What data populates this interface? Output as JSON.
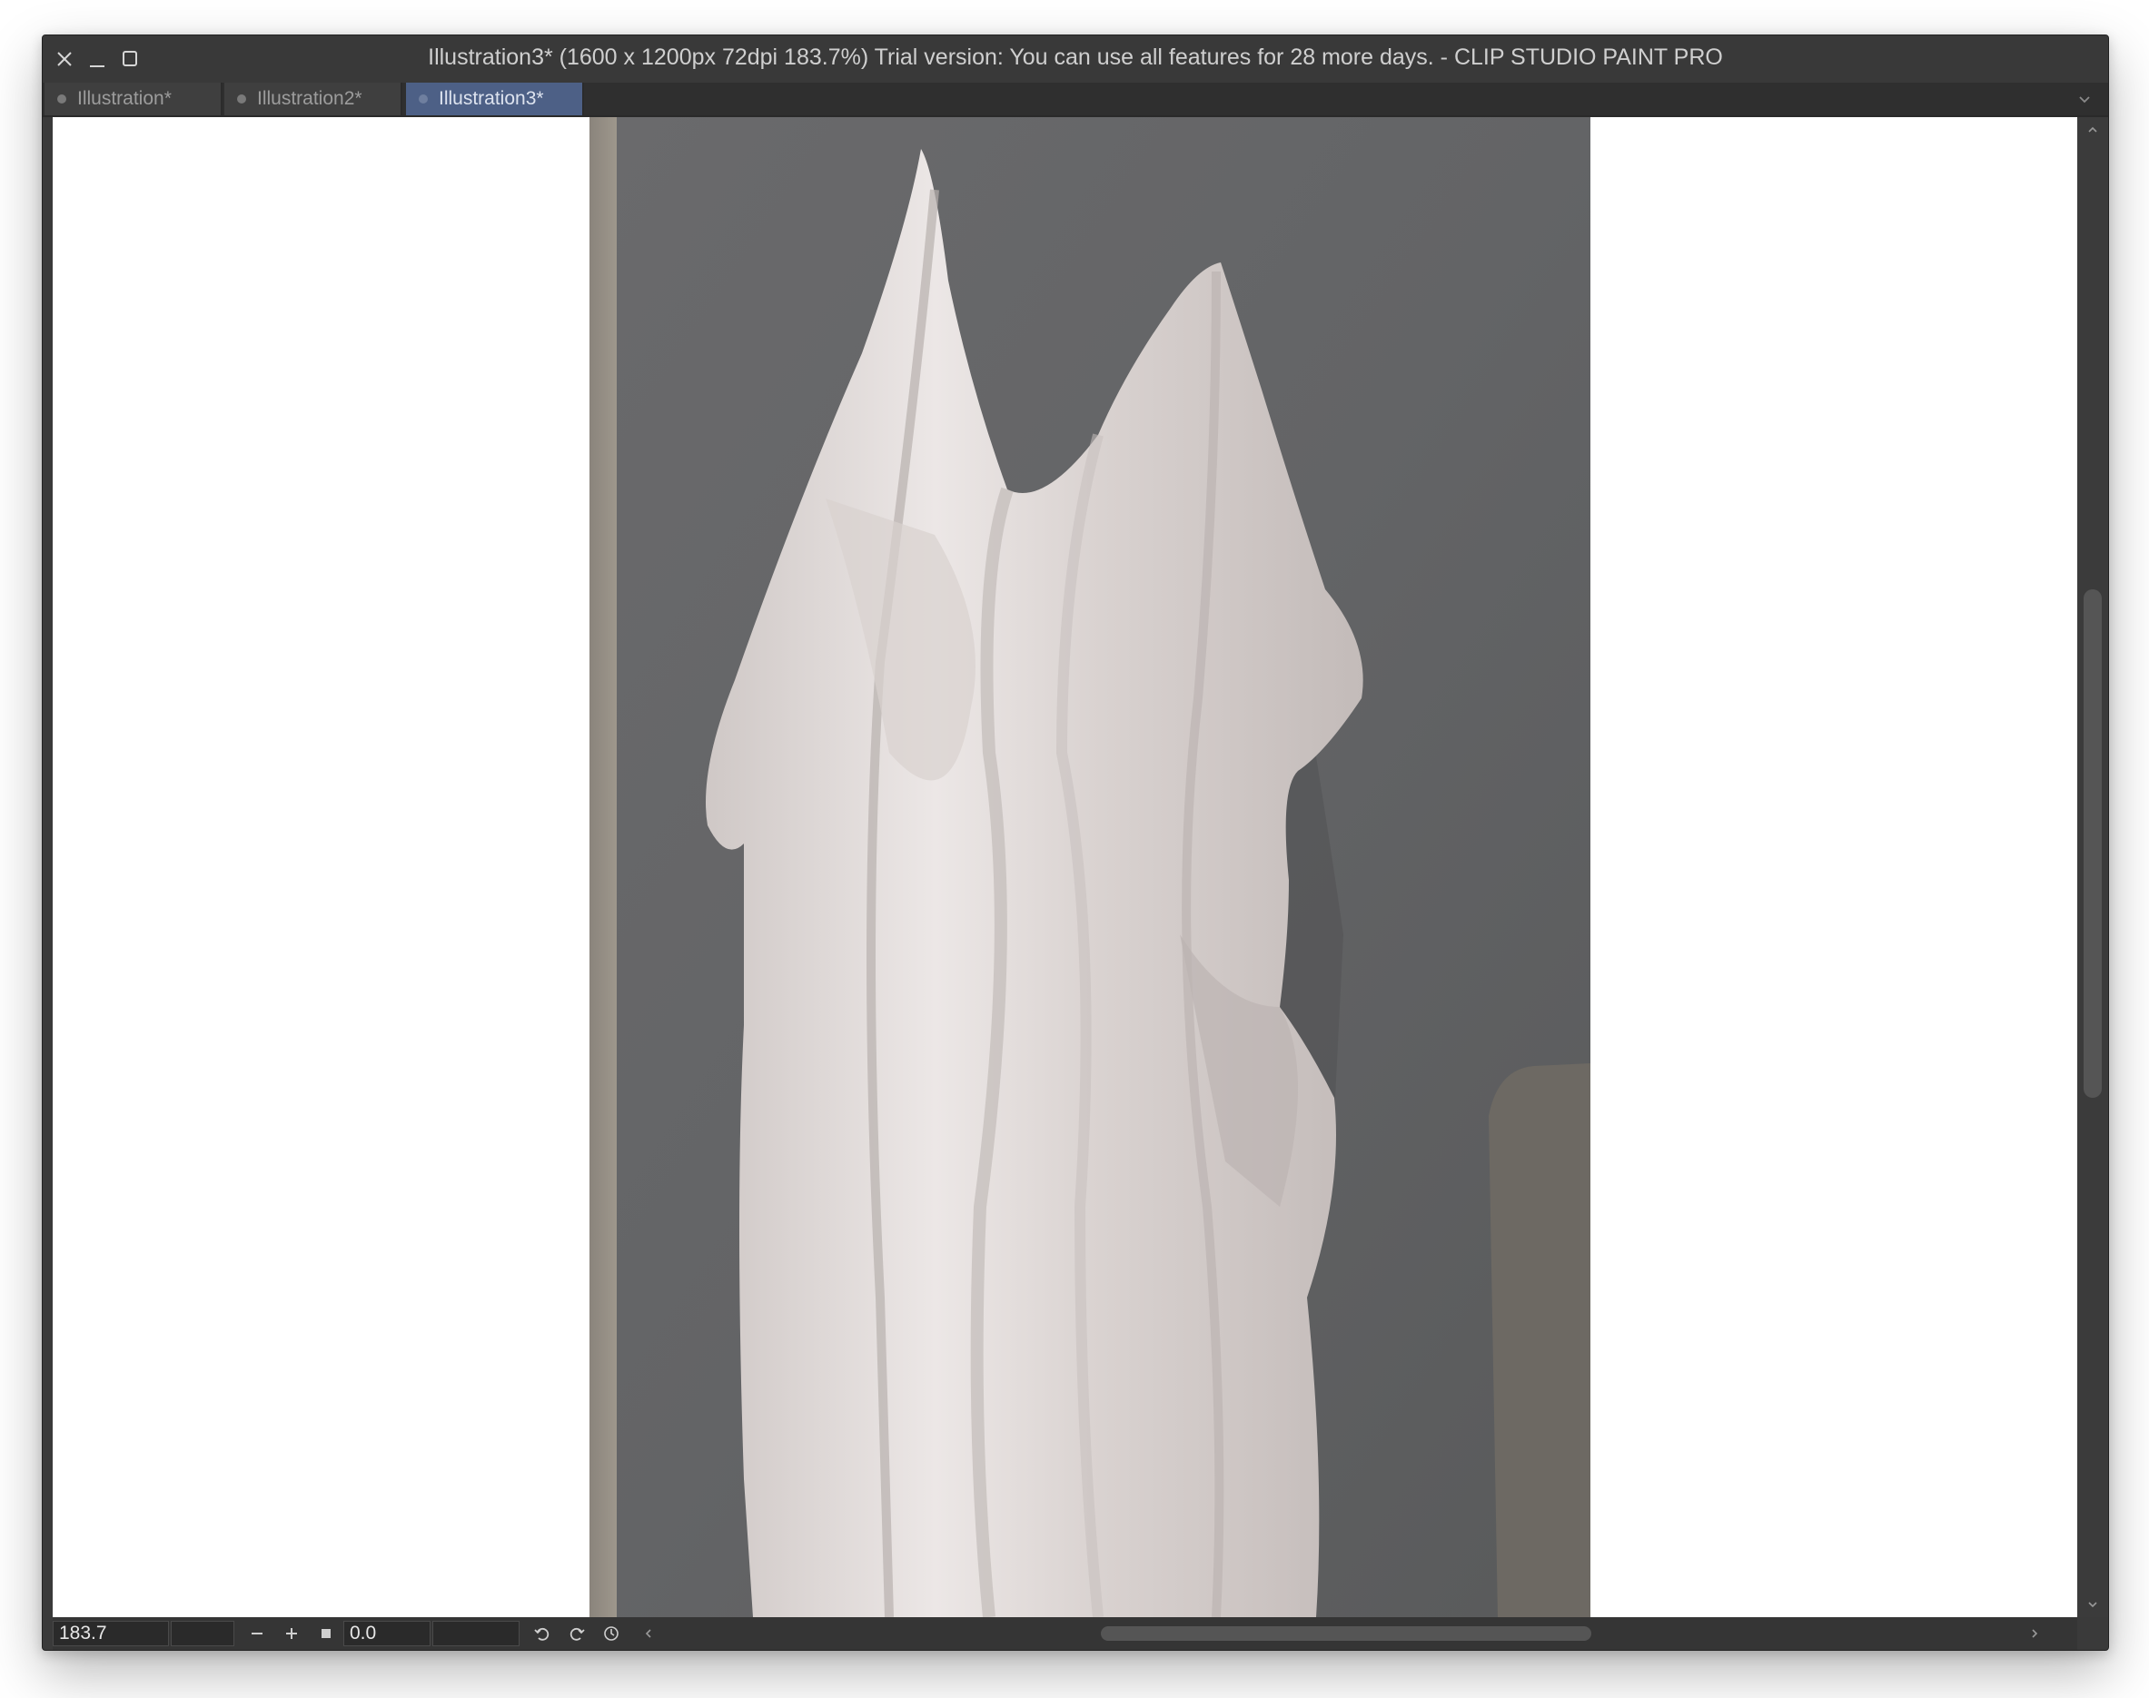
{
  "window": {
    "title": "Illustration3* (1600 x 1200px 72dpi 183.7%)  Trial version: You can use all features for 28 more days. - CLIP STUDIO PAINT PRO"
  },
  "tabs": [
    {
      "label": "Illustration*",
      "active": false
    },
    {
      "label": "Illustration2*",
      "active": false
    },
    {
      "label": "Illustration3*",
      "active": true
    }
  ],
  "statusbar": {
    "zoom_value": "183.7",
    "angle_value": "0.0"
  },
  "colors": {
    "accent_tab": "#4d6086",
    "chrome": "#393939",
    "canvas": "#ffffff"
  },
  "icons": [
    "close-icon",
    "minimize-icon",
    "maximize-icon",
    "tab-menu-chevron-icon",
    "zoom-out-icon",
    "zoom-in-icon",
    "fit-icon",
    "rotate-left-icon",
    "rotate-right-icon",
    "reset-rotation-icon"
  ]
}
